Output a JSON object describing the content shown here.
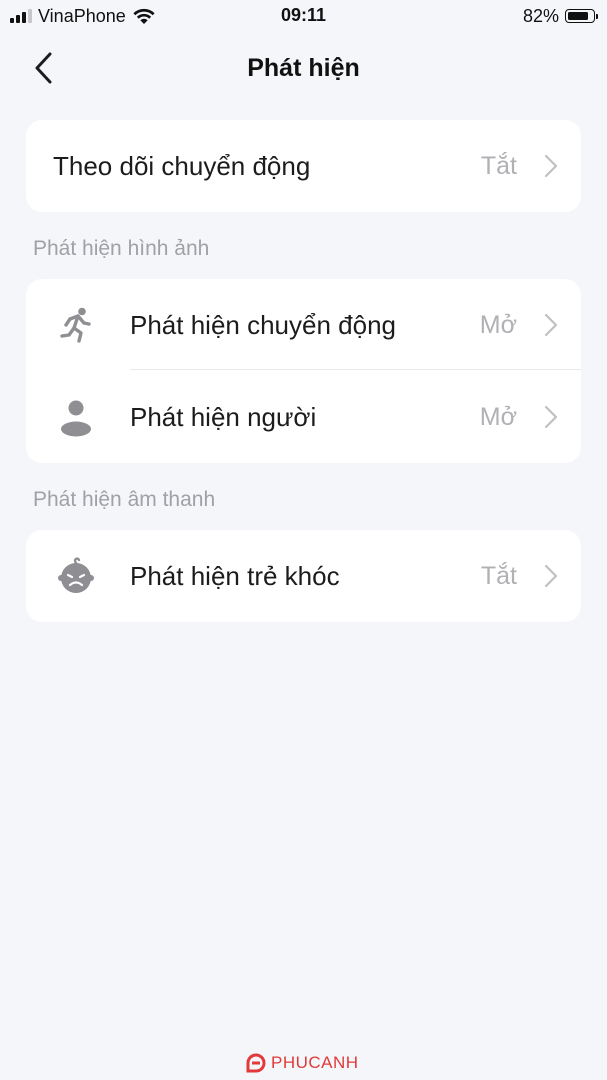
{
  "status_bar": {
    "carrier": "VinaPhone",
    "time": "09:11",
    "battery_percent": "82%",
    "battery_level": 0.82,
    "signal_bars": 3
  },
  "nav": {
    "title": "Phát hiện"
  },
  "motion_tracking": {
    "label": "Theo dõi chuyển động",
    "value": "Tắt"
  },
  "image_detection": {
    "header": "Phát hiện hình ảnh",
    "items": [
      {
        "label": "Phát hiện chuyển động",
        "value": "Mở",
        "icon": "running-person-icon"
      },
      {
        "label": "Phát hiện người",
        "value": "Mở",
        "icon": "person-icon"
      }
    ]
  },
  "sound_detection": {
    "header": "Phát hiện âm thanh",
    "items": [
      {
        "label": "Phát hiện trẻ khóc",
        "value": "Tắt",
        "icon": "crying-baby-icon"
      }
    ]
  },
  "watermark": {
    "text": "PHUCANH"
  },
  "colors": {
    "background": "#f5f6f9",
    "card": "#ffffff",
    "value_text": "#b0b0b5",
    "icon": "#8e8e93",
    "watermark": "#e03a3a"
  }
}
